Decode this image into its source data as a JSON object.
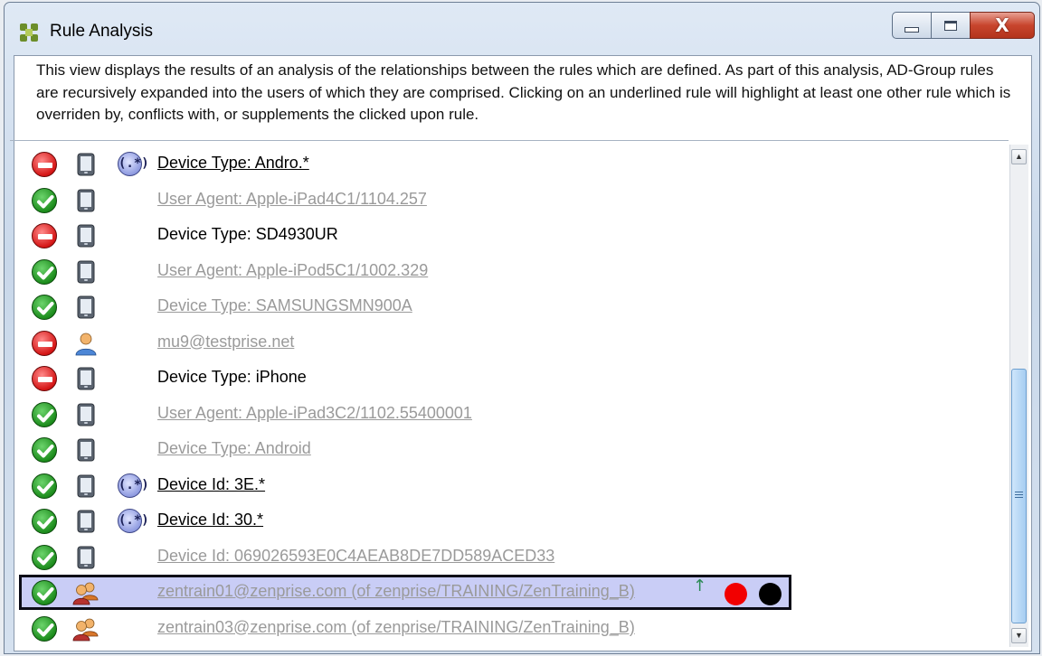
{
  "window": {
    "title": "Rule Analysis",
    "close_glyph": "X"
  },
  "description": "This view displays the results of an analysis of the relationships between the rules which are defined. As part of this analysis, AD-Group rules are recursively expanded into the users of which they are comprised. Clicking on an underlined rule will highlight at least one other rule which is overriden by, conflicts with, or supplements the clicked upon rule.",
  "regex_glyph": "(.*)",
  "rules": [
    {
      "status": "deny",
      "type": "device",
      "regex": true,
      "label": "Device Type: Andro.*",
      "style": "active"
    },
    {
      "status": "ok",
      "type": "device",
      "regex": false,
      "label": "User Agent: Apple-iPad4C1/1104.257",
      "style": "inactive"
    },
    {
      "status": "deny",
      "type": "device",
      "regex": false,
      "label": "Device Type: SD4930UR",
      "style": "plain"
    },
    {
      "status": "ok",
      "type": "device",
      "regex": false,
      "label": "User Agent: Apple-iPod5C1/1002.329",
      "style": "inactive"
    },
    {
      "status": "ok",
      "type": "device",
      "regex": false,
      "label": "Device Type: SAMSUNGSMN900A",
      "style": "inactive"
    },
    {
      "status": "deny",
      "type": "user",
      "regex": false,
      "label": "mu9@testprise.net",
      "style": "inactive"
    },
    {
      "status": "deny",
      "type": "device",
      "regex": false,
      "label": "Device Type: iPhone",
      "style": "plain"
    },
    {
      "status": "ok",
      "type": "device",
      "regex": false,
      "label": "User Agent: Apple-iPad3C2/1102.55400001",
      "style": "inactive"
    },
    {
      "status": "ok",
      "type": "device",
      "regex": false,
      "label": "Device Type: Android",
      "style": "inactive"
    },
    {
      "status": "ok",
      "type": "device",
      "regex": true,
      "label": "Device Id: 3E.*",
      "style": "active"
    },
    {
      "status": "ok",
      "type": "device",
      "regex": true,
      "label": "Device Id: 30.*",
      "style": "active"
    },
    {
      "status": "ok",
      "type": "device",
      "regex": false,
      "label": "Device Id: 069026593E0C4AEAB8DE7DD589ACED33",
      "style": "inactive"
    },
    {
      "status": "ok",
      "type": "group",
      "regex": false,
      "label": "zentrain01@zenprise.com (of zenprise/TRAINING/ZenTraining_B)",
      "style": "inactive",
      "selected": true,
      "arrow": "↑",
      "markers": [
        "red",
        "black"
      ]
    },
    {
      "status": "ok",
      "type": "group",
      "regex": false,
      "label": "zentrain03@zenprise.com (of zenprise/TRAINING/ZenTraining_B)",
      "style": "inactive"
    }
  ],
  "colors": {
    "selected_row": "#c9cdf6",
    "ok": "#1d8d1d",
    "deny": "#d51616",
    "inactive_text": "#9a9a9a",
    "marker_red": "#f20000",
    "marker_black": "#000000"
  },
  "scrollbar": {
    "up_glyph": "▲",
    "down_glyph": "▼"
  }
}
